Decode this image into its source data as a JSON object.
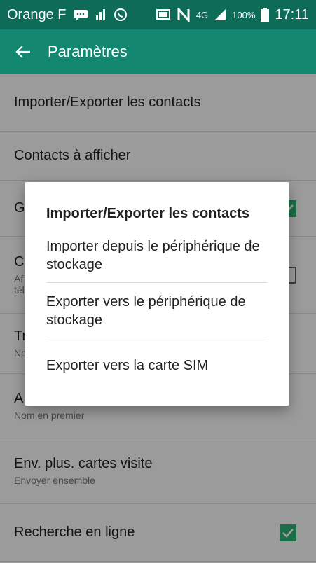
{
  "status_bar": {
    "carrier": "Orange F",
    "network_type": "4G",
    "battery": "100%",
    "time": "17:11",
    "icons": [
      "message-icon",
      "signal-bars-small-icon",
      "whatsapp-icon",
      "cast-icon",
      "nfc-icon",
      "cell-signal-icon",
      "battery-icon"
    ]
  },
  "appbar": {
    "title": "Paramètres",
    "back_icon": "back-arrow-icon"
  },
  "settings": [
    {
      "title": "Importer/Exporter les contacts",
      "subtitle": ""
    },
    {
      "title": "Contacts à afficher",
      "subtitle": ""
    },
    {
      "title": "G",
      "subtitle": "",
      "checkbox": true
    },
    {
      "title": "C",
      "subtitle": "Af\ntél",
      "checkbox": false
    },
    {
      "title": "Tr",
      "subtitle": "No"
    },
    {
      "title": "A",
      "subtitle": "Nom en premier"
    },
    {
      "title": "Env. plus. cartes visite",
      "subtitle": "Envoyer ensemble"
    },
    {
      "title": "Recherche en ligne",
      "subtitle": "",
      "checkbox": true
    }
  ],
  "dialog": {
    "title": "Importer/Exporter les contacts",
    "options": [
      "Importer depuis le périphérique de stockage",
      "Exporter vers le périphérique de stockage",
      "Exporter vers la carte SIM"
    ]
  },
  "colors": {
    "status_bar": "#0d6b58",
    "app_bar": "#13876f",
    "checkbox_on": "#2db273"
  }
}
